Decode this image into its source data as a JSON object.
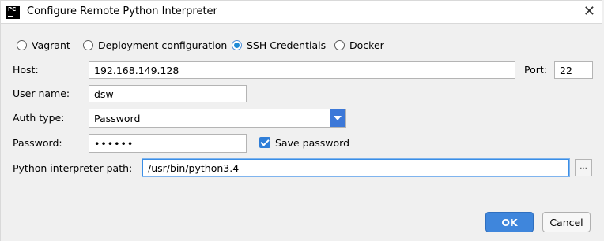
{
  "window": {
    "icon_text": "PC",
    "title": "Configure Remote Python Interpreter",
    "close_glyph": "✕"
  },
  "modes": [
    {
      "label": "Vagrant",
      "selected": false
    },
    {
      "label": "Deployment configuration",
      "selected": false
    },
    {
      "label": "SSH Credentials",
      "selected": true
    },
    {
      "label": "Docker",
      "selected": false
    }
  ],
  "form": {
    "host_label": "Host:",
    "host_value": "192.168.149.128",
    "port_label": "Port:",
    "port_value": "22",
    "username_label": "User name:",
    "username_value": "dsw",
    "authtype_label": "Auth type:",
    "authtype_value": "Password",
    "password_label": "Password:",
    "password_value": "••••••",
    "save_password_label": "Save password",
    "save_password_checked": true,
    "interpreter_label": "Python interpreter path:",
    "interpreter_value": "/usr/bin/python3.4",
    "browse_label": "..."
  },
  "buttons": {
    "ok": "OK",
    "cancel": "Cancel"
  },
  "colors": {
    "accent": "#3f86dc",
    "dropdown_arrow": "#3c78d8"
  }
}
